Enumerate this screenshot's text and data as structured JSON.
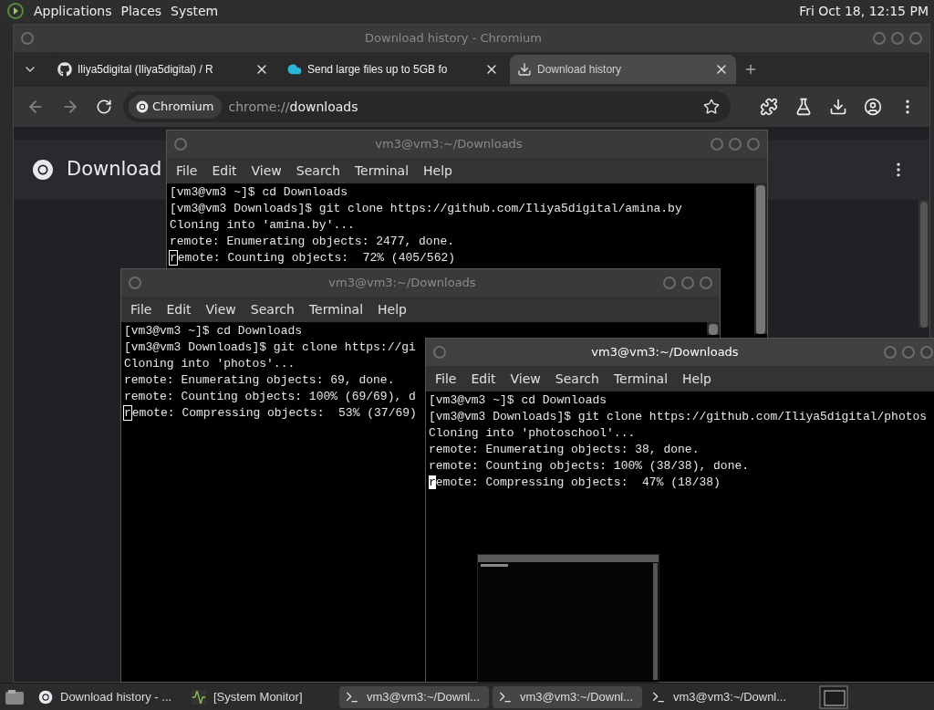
{
  "top_panel": {
    "menus": [
      "Applications",
      "Places",
      "System"
    ],
    "clock": "Fri Oct 18, 12:15 PM"
  },
  "browser": {
    "title": "Download history - Chromium",
    "active": false,
    "tabs": [
      {
        "label": "Iliya5digital (Iliya5digital) / R",
        "kind": "github",
        "selected": false
      },
      {
        "label": "Send large files up to 5GB fo",
        "kind": "cloud",
        "selected": false
      },
      {
        "label": "Download history",
        "kind": "download",
        "selected": true
      }
    ],
    "omnibox": {
      "chip": "Chromium",
      "scheme": "chrome://",
      "path": "downloads"
    },
    "page": {
      "heading": "Download"
    }
  },
  "terminals": [
    {
      "title": "vm3@vm3:~/Downloads",
      "active": false,
      "cursor_filled": false,
      "menu": [
        "File",
        "Edit",
        "View",
        "Search",
        "Terminal",
        "Help"
      ],
      "lines": [
        "[vm3@vm3 ~]$ cd Downloads",
        "[vm3@vm3 Downloads]$ git clone https://github.com/Iliya5digital/amina.by",
        "Cloning into 'amina.by'...",
        "remote: Enumerating objects: 2477, done.",
        "remote: Counting objects:  72% (405/562)"
      ]
    },
    {
      "title": "vm3@vm3:~/Downloads",
      "active": false,
      "cursor_filled": false,
      "menu": [
        "File",
        "Edit",
        "View",
        "Search",
        "Terminal",
        "Help"
      ],
      "lines": [
        "[vm3@vm3 ~]$ cd Downloads",
        "[vm3@vm3 Downloads]$ git clone https://gi",
        "Cloning into 'photos'...",
        "remote: Enumerating objects: 69, done.",
        "remote: Counting objects: 100% (69/69), d",
        "remote: Compressing objects:  53% (37/69)"
      ]
    },
    {
      "title": "vm3@vm3:~/Downloads",
      "active": true,
      "cursor_filled": true,
      "menu": [
        "File",
        "Edit",
        "View",
        "Search",
        "Terminal",
        "Help"
      ],
      "lines": [
        "[vm3@vm3 ~]$ cd Downloads",
        "[vm3@vm3 Downloads]$ git clone https://github.com/Iliya5digital/photos",
        "Cloning into 'photoschool'...",
        "remote: Enumerating objects: 38, done.",
        "remote: Counting objects: 100% (38/38), done.",
        "remote: Compressing objects:  47% (18/38)"
      ]
    }
  ],
  "taskbar": {
    "items": [
      {
        "label": "Download history - ...",
        "kind": "browser",
        "selected": false
      },
      {
        "label": "[System Monitor]",
        "kind": "monitor",
        "selected": false
      },
      {
        "label": "vm3@vm3:~/Downl...",
        "kind": "terminal",
        "selected": true
      },
      {
        "label": "vm3@vm3:~/Downl...",
        "kind": "terminal",
        "selected": true
      },
      {
        "label": "vm3@vm3:~/Downl...",
        "kind": "terminal",
        "selected": false
      }
    ]
  }
}
